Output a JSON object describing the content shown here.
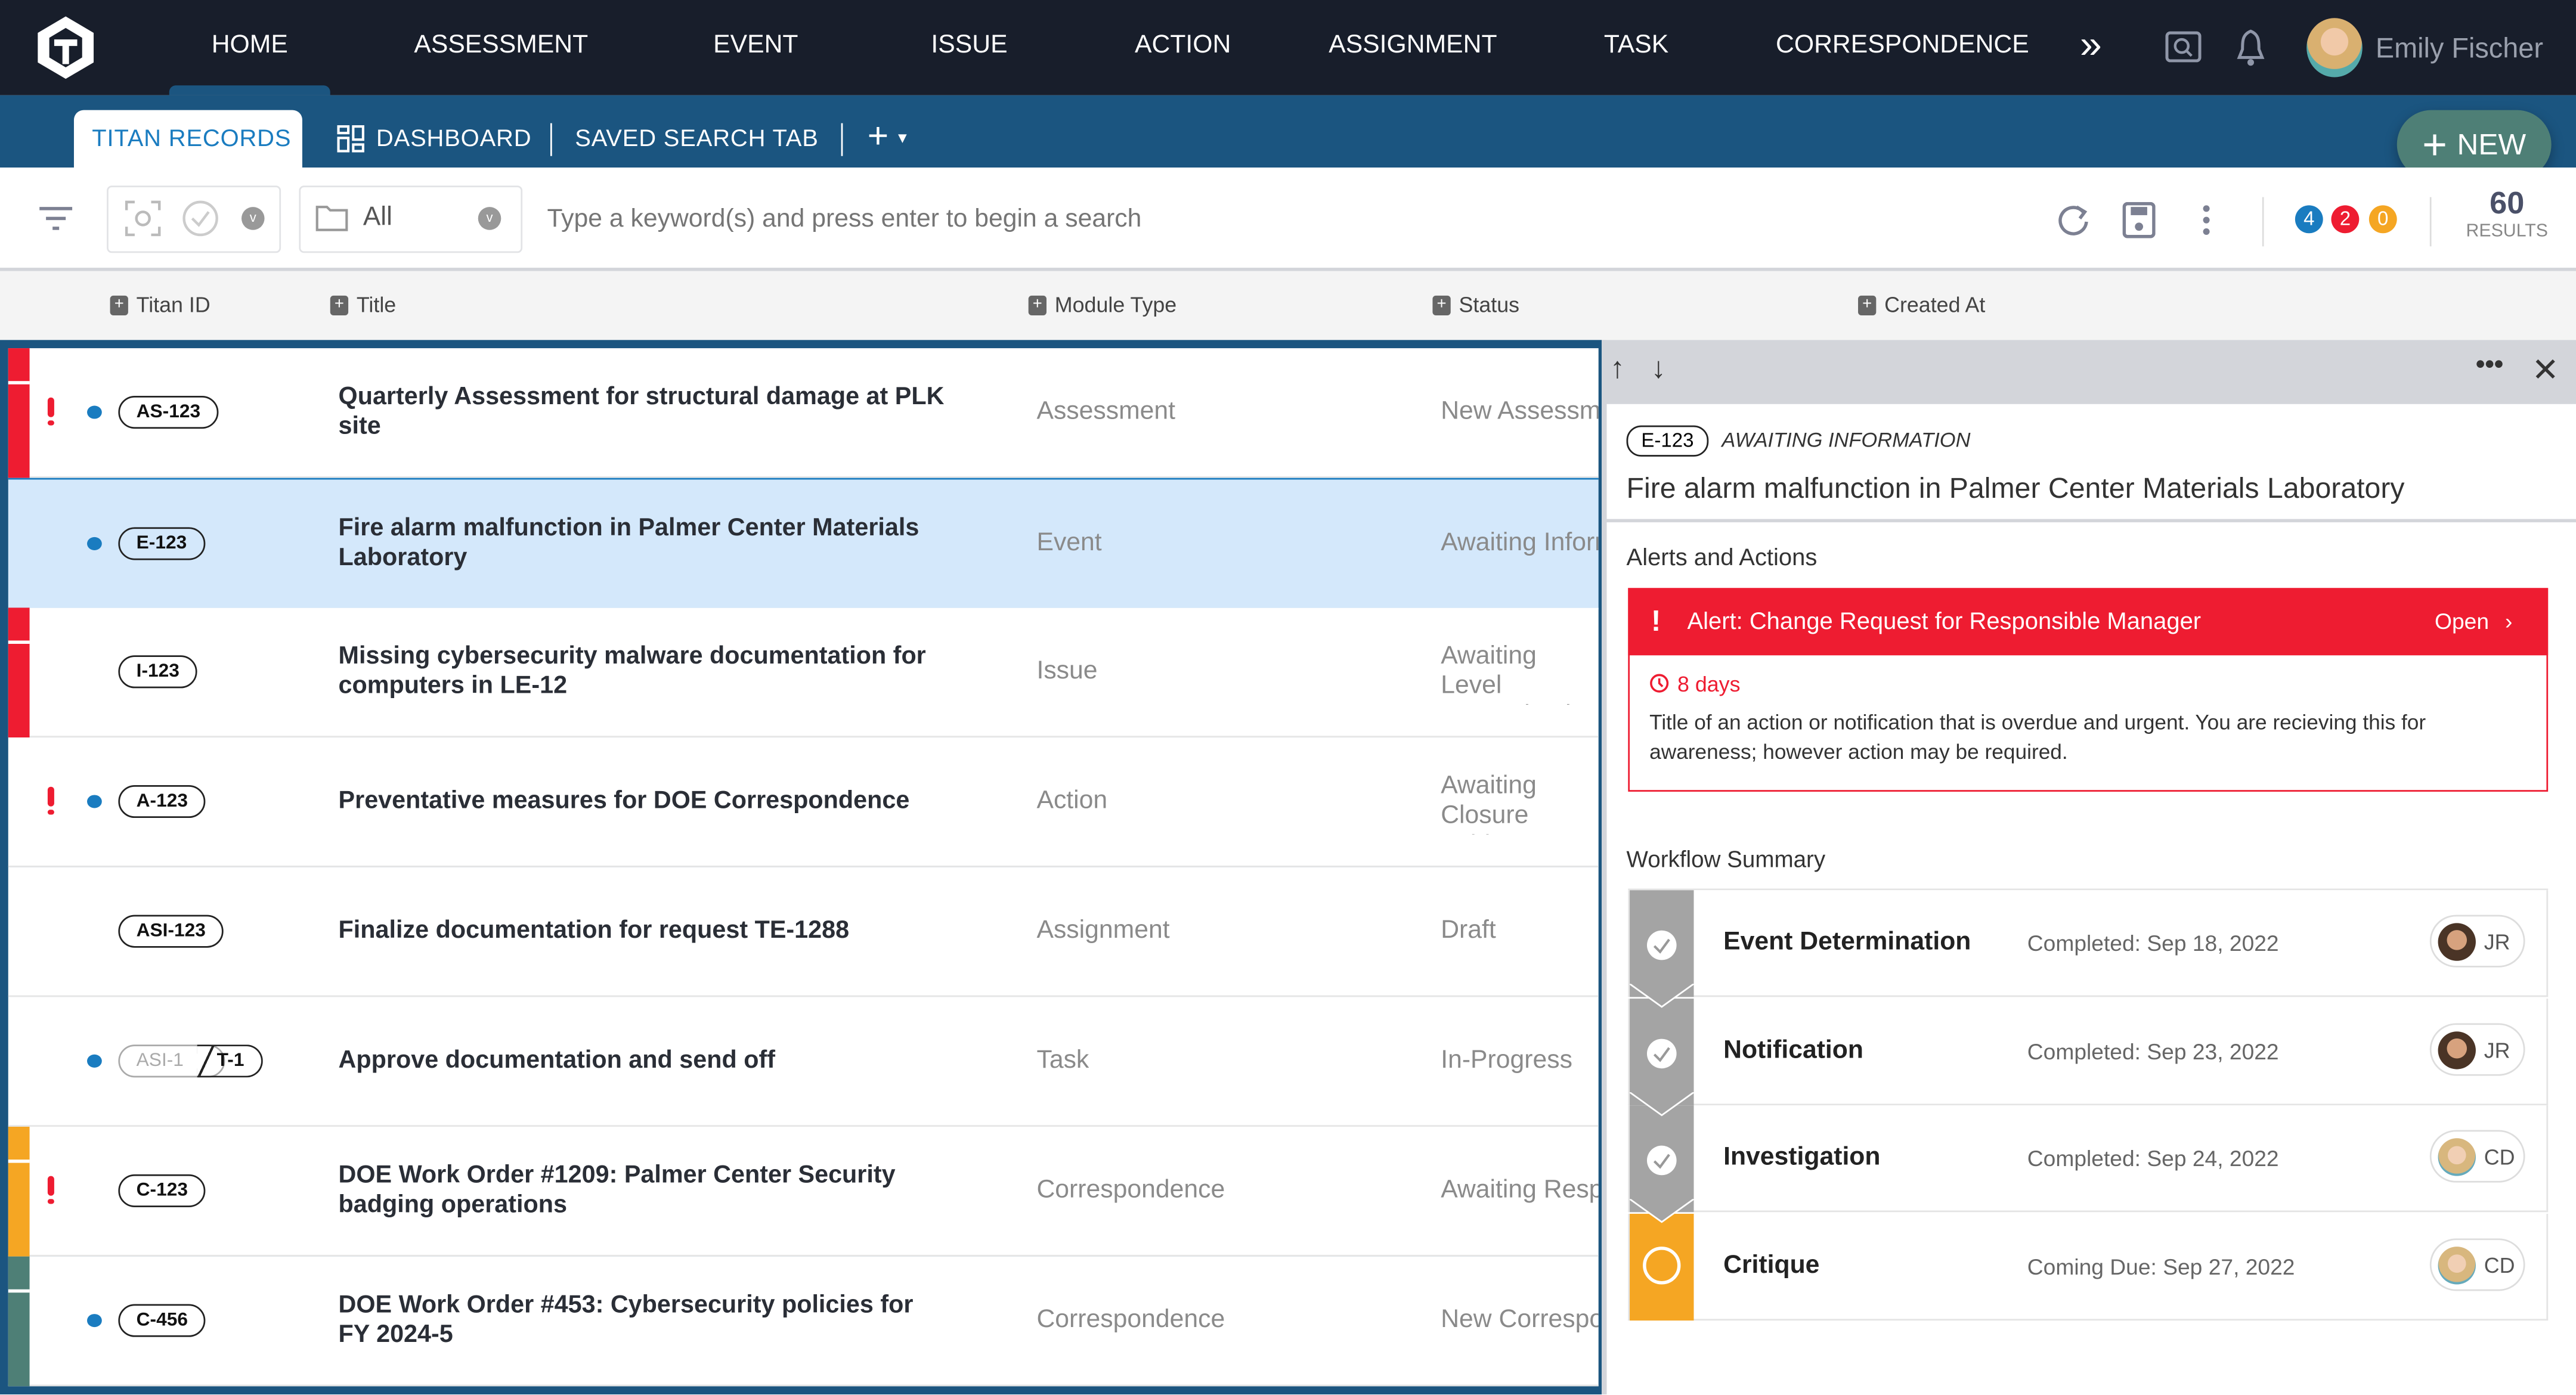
{
  "nav": {
    "items": [
      "HOME",
      "ASSESSMENT",
      "EVENT",
      "ISSUE",
      "ACTION",
      "ASSIGNMENT",
      "TASK",
      "CORRESPONDENCE"
    ],
    "active": "HOME",
    "more_icon": "double-chevron-right",
    "user_name": "Emily Fischer"
  },
  "tabs": {
    "items": [
      "TITAN RECORDS",
      "DASHBOARD",
      "SAVED SEARCH TAB"
    ],
    "active": "TITAN RECORDS",
    "new_label": "NEW"
  },
  "toolbar": {
    "scope_value": "All",
    "search_placeholder": "Type a keyword(s) and press enter to begin a search",
    "counts": [
      {
        "value": "4",
        "color": "#1a7cc0"
      },
      {
        "value": "2",
        "color": "#ee1c31"
      },
      {
        "value": "0",
        "color": "#f5a623"
      }
    ],
    "results_count": "60",
    "results_label": "RESULTS"
  },
  "columns": [
    "Titan ID",
    "Title",
    "Module Type",
    "Status",
    "Created At"
  ],
  "rows": [
    {
      "id": "AS-123",
      "title": "Quarterly Assessment for structural damage at PLK site",
      "module": "Assessment",
      "status": "New Assessment",
      "urgent": true,
      "unread": true,
      "strip": "#ee1c31"
    },
    {
      "id": "E-123",
      "title": "Fire alarm malfunction in Palmer Center Materials Laboratory",
      "module": "Event",
      "status": "Awaiting Information",
      "urgent": false,
      "unread": true,
      "strip": "",
      "selected": true
    },
    {
      "id": "I-123",
      "title": "Missing cybersecurity malware documentation for computers in LE-12",
      "module": "Issue",
      "status": "Awaiting Level Determination",
      "urgent": false,
      "unread": false,
      "strip": "#ee1c31"
    },
    {
      "id": "A-123",
      "title": "Preventative measures for DOE Correspondence",
      "module": "Action",
      "status": "Awaiting Closure Evidence",
      "urgent": true,
      "unread": true,
      "strip": ""
    },
    {
      "id": "ASI-123",
      "title": "Finalize documentation for request TE-1288",
      "module": "Assignment",
      "status": "Draft",
      "urgent": false,
      "unread": false,
      "strip": ""
    },
    {
      "id": "T-1",
      "parent_id": "ASI-1",
      "title": "Approve documentation and send off",
      "module": "Task",
      "status": "In-Progress",
      "urgent": false,
      "unread": true,
      "strip": ""
    },
    {
      "id": "C-123",
      "title": "DOE Work Order #1209: Palmer Center Security badging operations",
      "module": "Correspondence",
      "status": "Awaiting Response",
      "urgent": true,
      "unread": false,
      "strip": "#f5a623"
    },
    {
      "id": "C-456",
      "title": "DOE Work Order #453: Cybersecurity policies for FY 2024-5",
      "module": "Correspondence",
      "status": "New Correspondence",
      "urgent": false,
      "unread": true,
      "strip": "#4e7f76"
    }
  ],
  "detail": {
    "id": "E-123",
    "status": "AWAITING INFORMATION",
    "title": "Fire alarm malfunction in Palmer Center Materials Laboratory",
    "alerts_heading": "Alerts and Actions",
    "alert": {
      "title": "Alert: Change Request for Responsible Manager",
      "open_label": "Open",
      "age": "8 days",
      "description": "Title of an action or notification that is overdue and urgent. You are recieving this for awareness; however action may be required.",
      "color": "#ee1c31"
    },
    "workflow_heading": "Workflow Summary",
    "workflow": [
      {
        "name": "Event Determination",
        "date": "Completed: Sep 18, 2022",
        "assignee": "JR",
        "state": "complete"
      },
      {
        "name": "Notification",
        "date": "Completed: Sep 23, 2022",
        "assignee": "JR",
        "state": "complete"
      },
      {
        "name": "Investigation",
        "date": "Completed: Sep 24, 2022",
        "assignee": "CD",
        "state": "complete"
      },
      {
        "name": "Critique",
        "date": "Coming Due: Sep 27, 2022",
        "assignee": "CD",
        "state": "current"
      }
    ]
  }
}
